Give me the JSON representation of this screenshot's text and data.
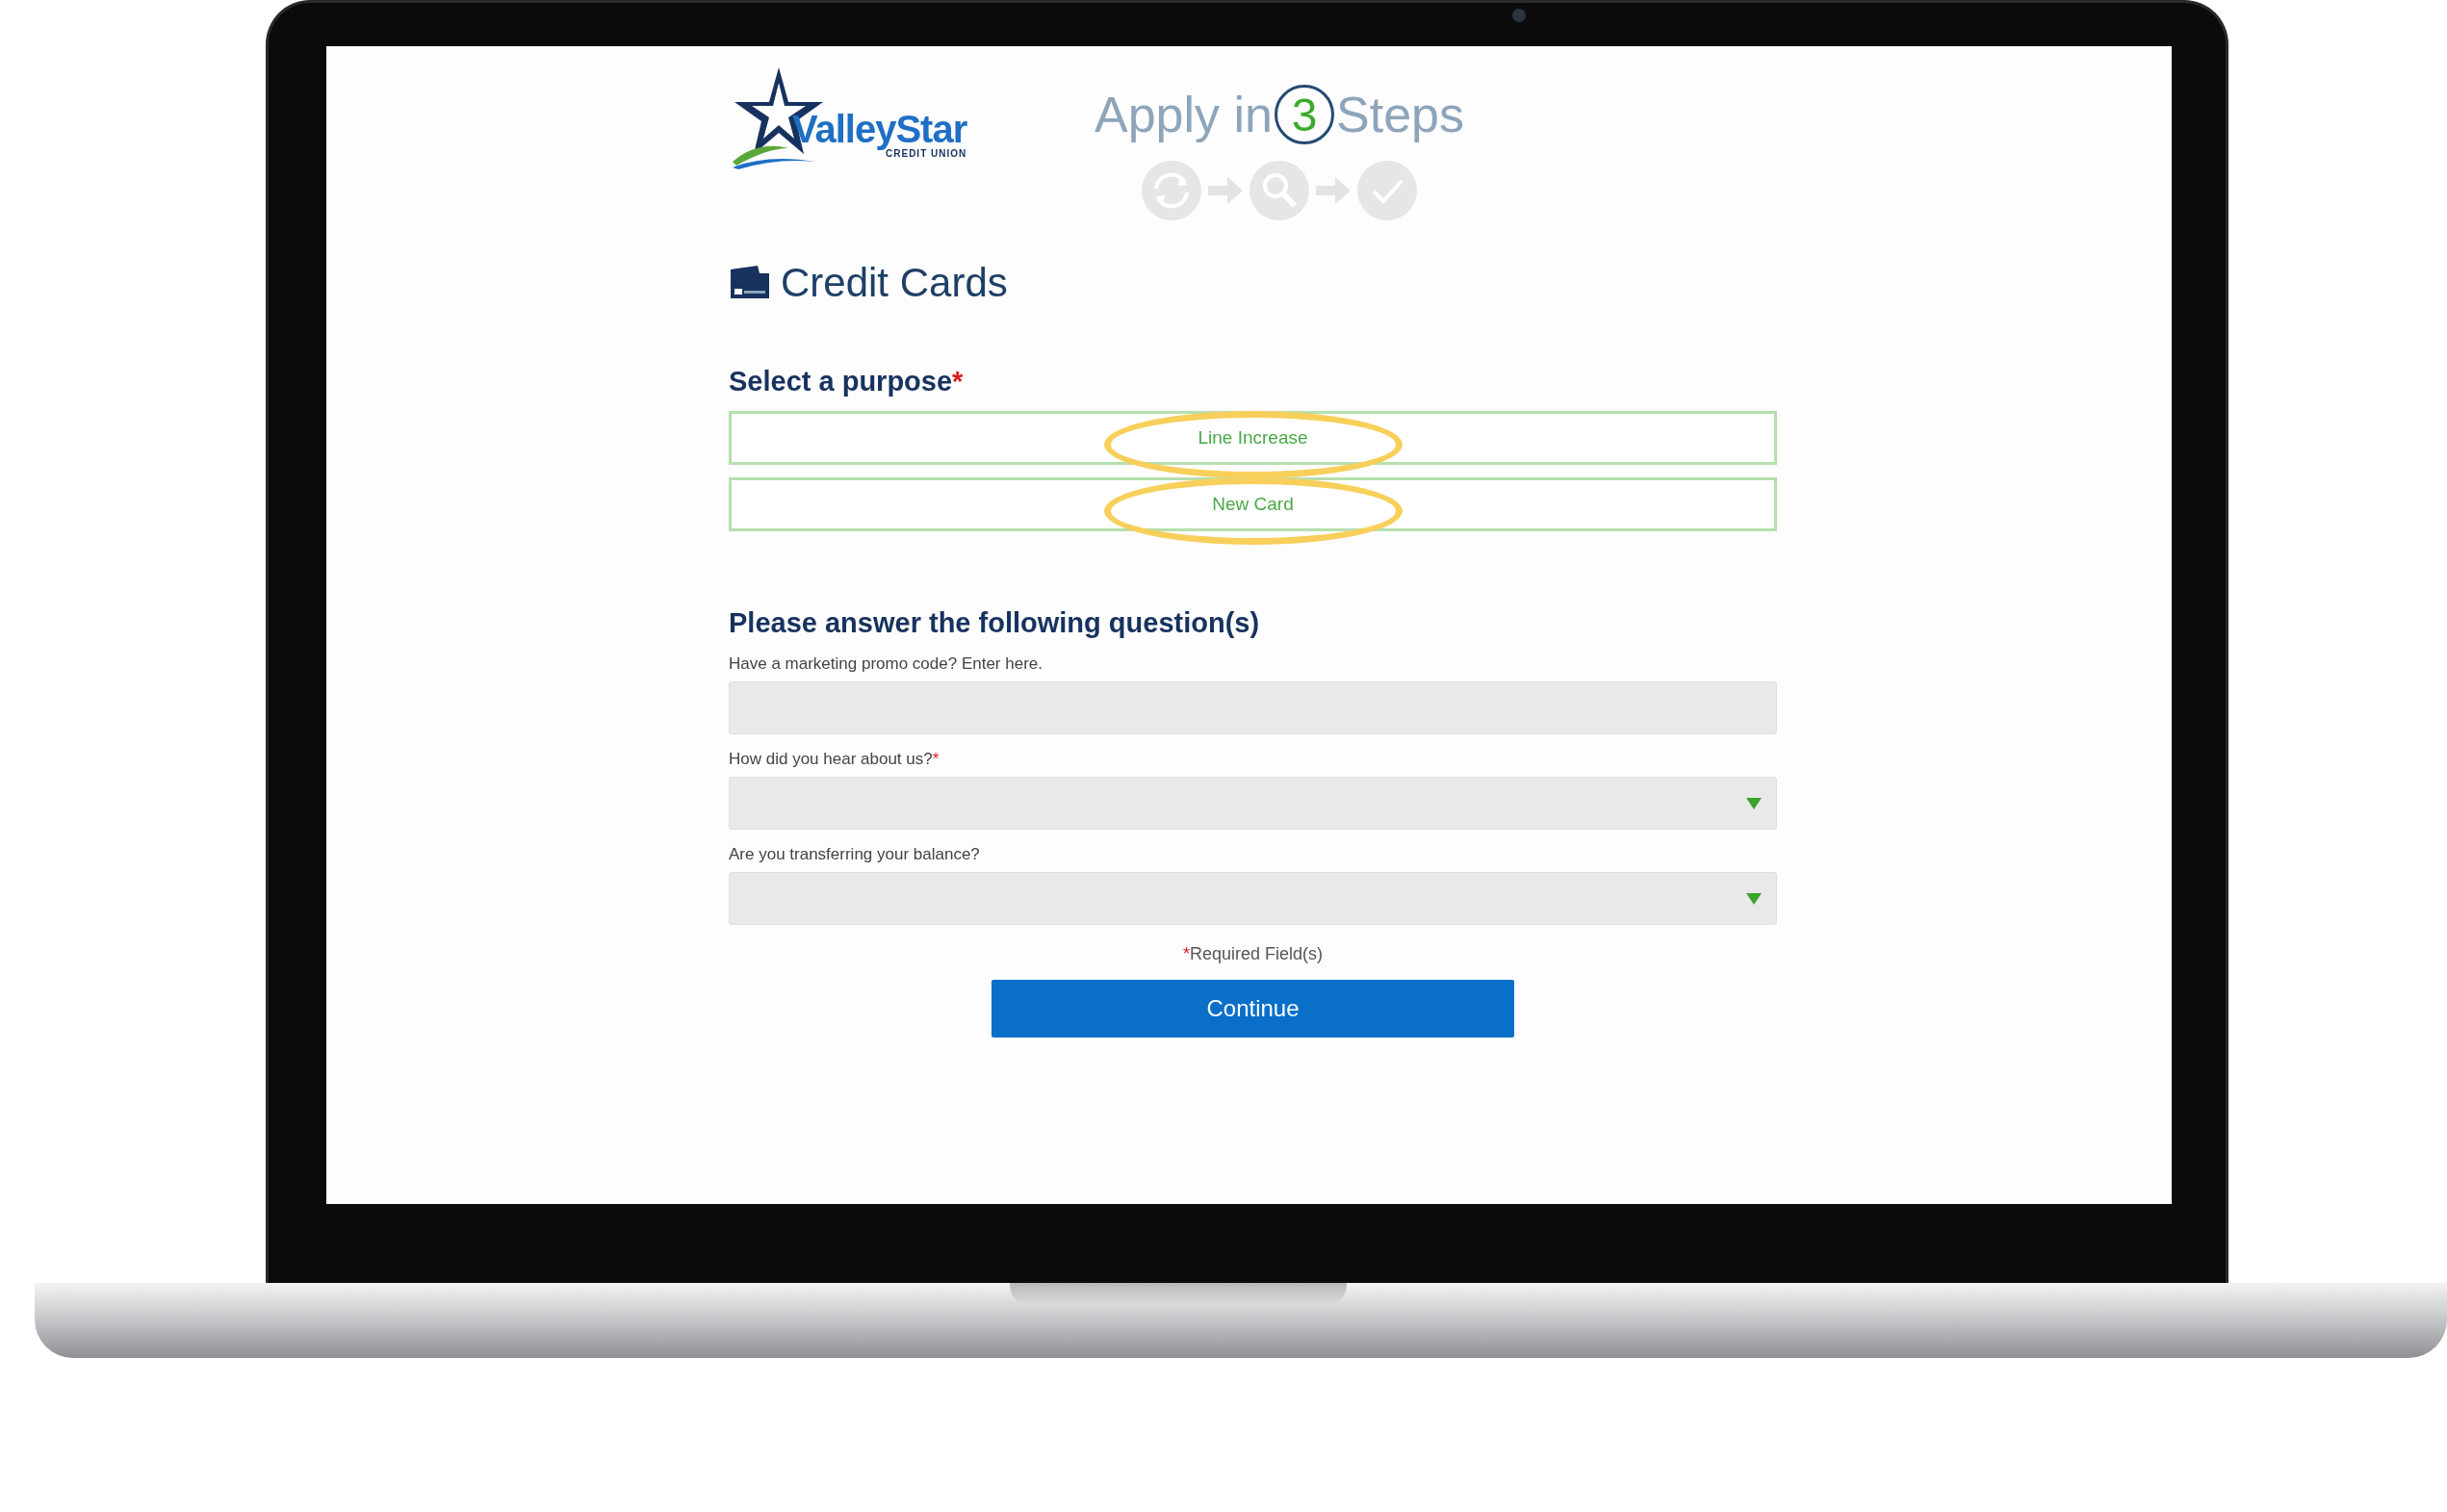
{
  "header": {
    "logo": {
      "name": "ValleyStar",
      "tagline": "CREDIT UNION"
    },
    "apply": {
      "prefix": "Apply in",
      "number": "3",
      "suffix": "Steps"
    }
  },
  "page_title": "Credit Cards",
  "purpose": {
    "label": "Select a purpose",
    "required": true,
    "required_mark": "*",
    "options": [
      {
        "label": "Line Increase",
        "highlighted": true
      },
      {
        "label": "New Card",
        "highlighted": true
      }
    ]
  },
  "questions": {
    "heading": "Please answer the following question(s)",
    "fields": [
      {
        "kind": "text",
        "label": "Have a marketing promo code? Enter here.",
        "required": false
      },
      {
        "kind": "select",
        "label": "How did you hear about us?",
        "required": true
      },
      {
        "kind": "select",
        "label": "Are you transferring your balance?",
        "required": false
      }
    ]
  },
  "required_note": {
    "mark": "*",
    "text": "Required Field(s)"
  },
  "continue_button": "Continue"
}
